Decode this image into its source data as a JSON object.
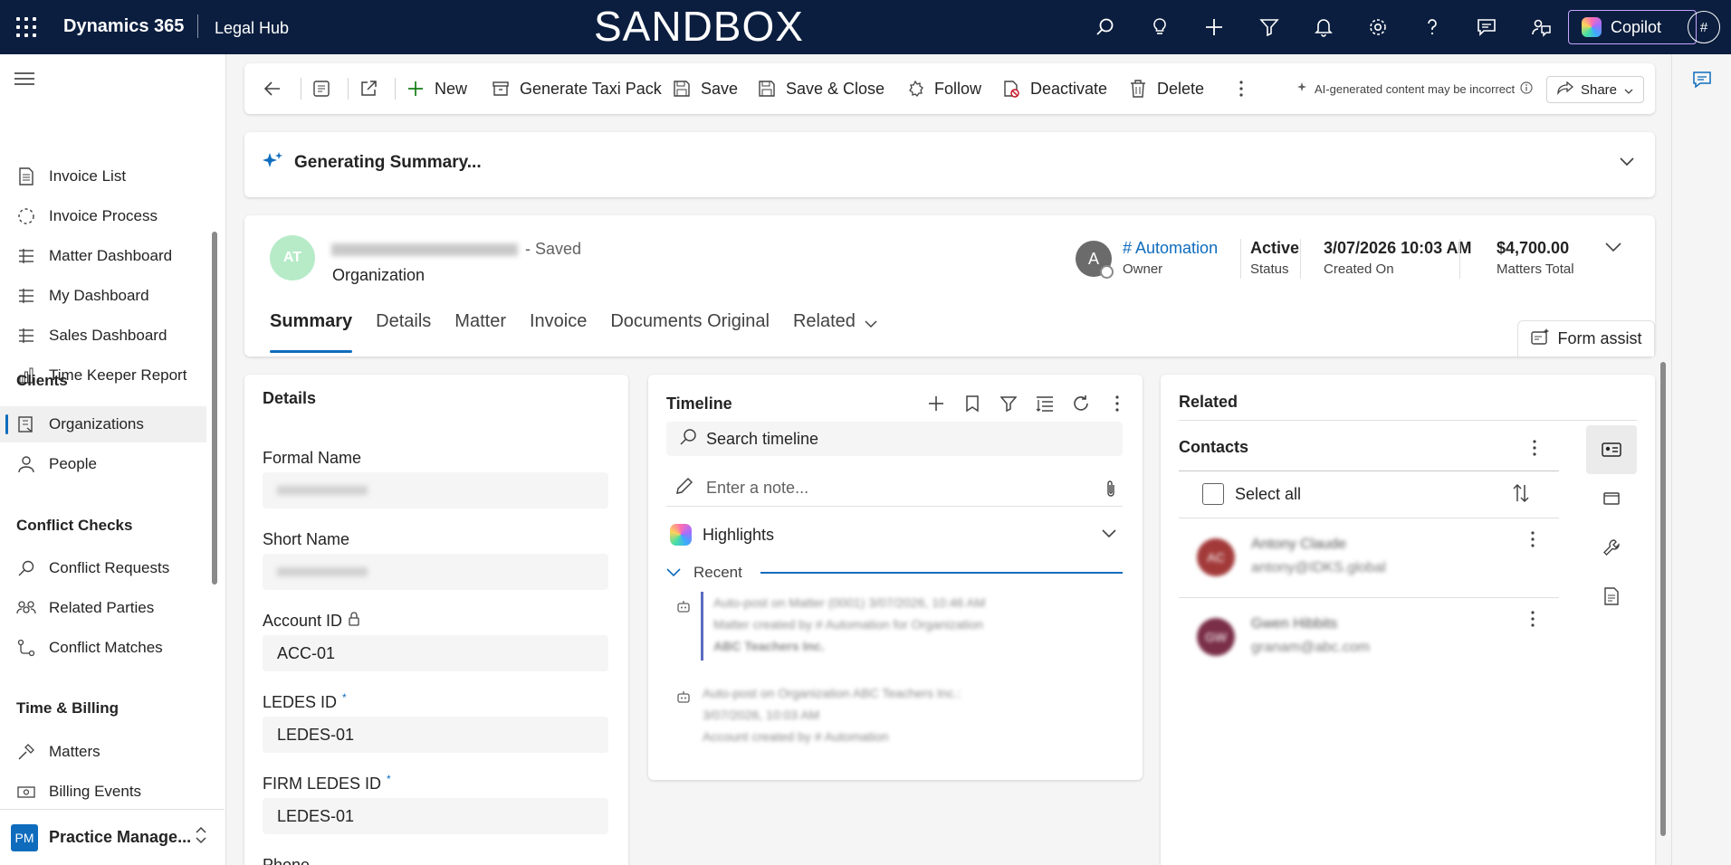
{
  "topbar": {
    "app_name": "Dynamics 365",
    "area_name": "Legal Hub",
    "environment_label": "SANDBOX",
    "icons": [
      "search-icon",
      "lightbulb-icon",
      "plus-icon",
      "filter-icon",
      "bell-icon",
      "settings-icon",
      "help-icon",
      "chat-icon",
      "feedback-icon"
    ],
    "copilot_label": "Copilot",
    "user_initial": "#"
  },
  "sidebar": {
    "items_top": [
      {
        "label": "Invoice List",
        "icon": "document-icon"
      },
      {
        "label": "Invoice Process",
        "icon": "process-icon"
      },
      {
        "label": "Matter Dashboard",
        "icon": "dashboard-icon"
      },
      {
        "label": "My Dashboard",
        "icon": "dashboard-icon"
      },
      {
        "label": "Sales Dashboard",
        "icon": "dashboard-icon"
      },
      {
        "label": "Time Keeper Report",
        "icon": "report-icon"
      }
    ],
    "groups": {
      "clients": {
        "title": "Clients",
        "items": [
          "Organizations",
          "People"
        ]
      },
      "conflict": {
        "title": "Conflict Checks",
        "items": [
          "Conflict Requests",
          "Related Parties",
          "Conflict Matches"
        ]
      },
      "billing": {
        "title": "Time & Billing",
        "items": [
          "Matters",
          "Billing Events"
        ]
      }
    },
    "area_switcher": {
      "badge": "PM",
      "label": "Practice Manage..."
    }
  },
  "commandbar": {
    "new": "New",
    "generate_taxi": "Generate Taxi Pack",
    "save": "Save",
    "save_close": "Save & Close",
    "follow": "Follow",
    "deactivate": "Deactivate",
    "delete": "Delete",
    "ai_note": "AI-generated content may be incorrect",
    "share": "Share"
  },
  "summary": {
    "title": "Generating Summary..."
  },
  "record": {
    "initials": "AT",
    "saved_status": "- Saved",
    "entity_type": "Organization",
    "owner_initial": "A",
    "owner_name": "# Automation",
    "owner_label": "Owner",
    "status_value": "Active",
    "status_label": "Status",
    "created_value": "3/07/2026 10:03 AM",
    "created_label": "Created On",
    "total_value": "$4,700.00",
    "total_label": "Matters Total",
    "tabs": [
      "Summary",
      "Details",
      "Matter",
      "Invoice",
      "Documents Original",
      "Related"
    ],
    "form_assist": "Form assist"
  },
  "details": {
    "title": "Details",
    "formal_name_label": "Formal Name",
    "short_name_label": "Short Name",
    "account_id_label": "Account ID",
    "account_id_value": "ACC-01",
    "ledes_id_label": "LEDES ID",
    "ledes_id_value": "LEDES-01",
    "firm_ledes_label": "FIRM LEDES ID",
    "firm_ledes_value": "LEDES-01",
    "phone_label": "Phone",
    "required_mark": "*"
  },
  "timeline": {
    "title": "Timeline",
    "search_placeholder": "Search timeline",
    "note_placeholder": "Enter a note...",
    "highlights": "Highlights",
    "recent": "Recent",
    "entries": [
      {
        "line1": "Auto-post on Matter (0001)   3/07/2026, 10:46 AM",
        "line2": "Matter created by # Automation for Organization",
        "line3": "ABC Teachers Inc."
      },
      {
        "line1": "Auto-post on Organization ABC Teachers Inc.:",
        "line2": "3/07/2026, 10:03 AM",
        "line3": "Account created by # Automation"
      }
    ]
  },
  "related": {
    "title": "Related",
    "contacts_title": "Contacts",
    "select_all": "Select all",
    "contacts": [
      {
        "initials": "AC",
        "name": "Antony Claude",
        "email": "antony@IDKS.global",
        "color": "#a33a3a"
      },
      {
        "initials": "GW",
        "name": "Gwen Hibbits",
        "email": "granam@abc.com",
        "color": "#7a2e48"
      }
    ]
  }
}
